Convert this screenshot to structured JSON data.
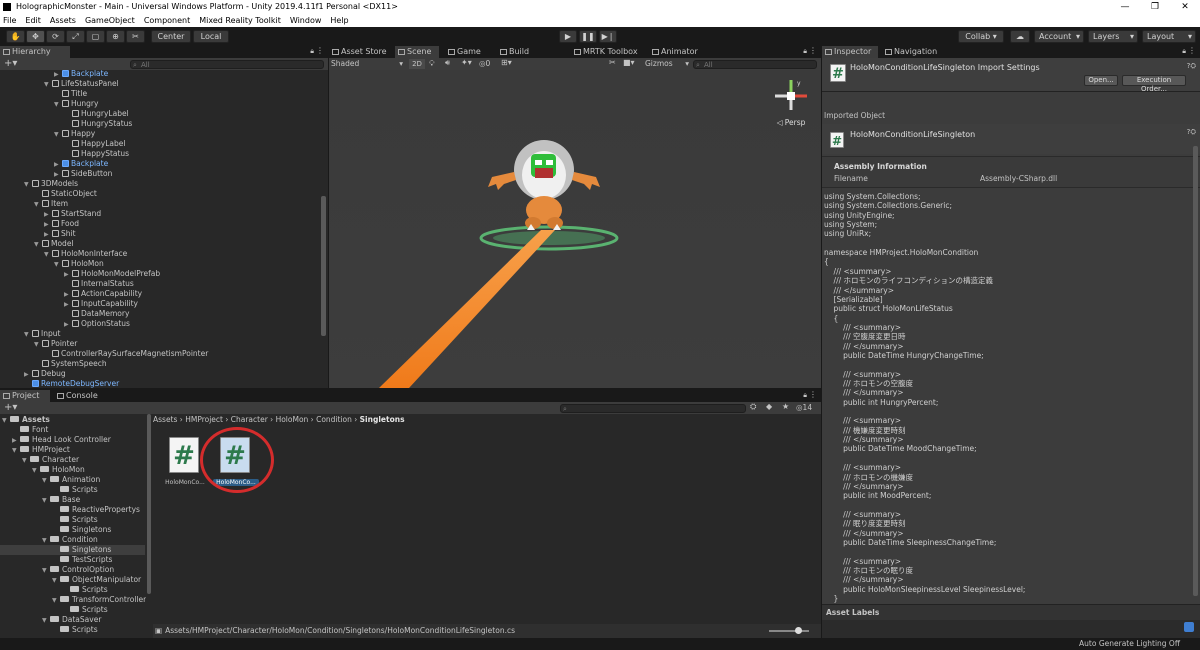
{
  "window": {
    "title": "HolographicMonster - Main - Universal Windows Platform - Unity 2019.4.11f1 Personal <DX11>",
    "controls": [
      "—",
      "❐",
      "✕"
    ]
  },
  "menu": [
    "File",
    "Edit",
    "Assets",
    "GameObject",
    "Component",
    "Mixed Reality Toolkit",
    "Window",
    "Help"
  ],
  "toolbar": {
    "center_label": "Center",
    "local_label": "Local",
    "collab_label": "Collab ▾",
    "account_label": "Account",
    "layers_label": "Layers",
    "layout_label": "Layout"
  },
  "hierarchy": {
    "tab": "Hierarchy",
    "search_placeholder": "All",
    "rows": [
      {
        "label": "Backplate",
        "indent": 5,
        "arrow": "▶",
        "blue": true
      },
      {
        "label": "LifeStatusPanel",
        "indent": 4,
        "arrow": "▼",
        "blue": false
      },
      {
        "label": "Title",
        "indent": 5,
        "arrow": "",
        "blue": false
      },
      {
        "label": "Hungry",
        "indent": 5,
        "arrow": "▼",
        "blue": false
      },
      {
        "label": "HungryLabel",
        "indent": 6,
        "arrow": "",
        "blue": false
      },
      {
        "label": "HungryStatus",
        "indent": 6,
        "arrow": "",
        "blue": false
      },
      {
        "label": "Happy",
        "indent": 5,
        "arrow": "▼",
        "blue": false
      },
      {
        "label": "HappyLabel",
        "indent": 6,
        "arrow": "",
        "blue": false
      },
      {
        "label": "HappyStatus",
        "indent": 6,
        "arrow": "",
        "blue": false
      },
      {
        "label": "Backplate",
        "indent": 5,
        "arrow": "▶",
        "blue": true
      },
      {
        "label": "SideButton",
        "indent": 5,
        "arrow": "▶",
        "blue": false
      },
      {
        "label": "3DModels",
        "indent": 2,
        "arrow": "▼",
        "blue": false
      },
      {
        "label": "StaticObject",
        "indent": 3,
        "arrow": "",
        "blue": false
      },
      {
        "label": "Item",
        "indent": 3,
        "arrow": "▼",
        "blue": false
      },
      {
        "label": "StartStand",
        "indent": 4,
        "arrow": "▶",
        "blue": false
      },
      {
        "label": "Food",
        "indent": 4,
        "arrow": "▶",
        "blue": false
      },
      {
        "label": "Shit",
        "indent": 4,
        "arrow": "▶",
        "blue": false
      },
      {
        "label": "Model",
        "indent": 3,
        "arrow": "▼",
        "blue": false
      },
      {
        "label": "HoloMonInterface",
        "indent": 4,
        "arrow": "▼",
        "blue": false
      },
      {
        "label": "HoloMon",
        "indent": 5,
        "arrow": "▼",
        "blue": false
      },
      {
        "label": "HoloMonModelPrefab",
        "indent": 6,
        "arrow": "▶",
        "blue": false
      },
      {
        "label": "InternalStatus",
        "indent": 6,
        "arrow": "",
        "blue": false
      },
      {
        "label": "ActionCapability",
        "indent": 6,
        "arrow": "▶",
        "blue": false
      },
      {
        "label": "InputCapability",
        "indent": 6,
        "arrow": "▶",
        "blue": false
      },
      {
        "label": "DataMemory",
        "indent": 6,
        "arrow": "",
        "blue": false
      },
      {
        "label": "OptionStatus",
        "indent": 6,
        "arrow": "▶",
        "blue": false
      },
      {
        "label": "Input",
        "indent": 2,
        "arrow": "▼",
        "blue": false
      },
      {
        "label": "Pointer",
        "indent": 3,
        "arrow": "▼",
        "blue": false
      },
      {
        "label": "ControllerRaySurfaceMagnetismPointer",
        "indent": 4,
        "arrow": "",
        "blue": false
      },
      {
        "label": "SystemSpeech",
        "indent": 3,
        "arrow": "",
        "blue": false
      },
      {
        "label": "Debug",
        "indent": 2,
        "arrow": "▶",
        "blue": false
      },
      {
        "label": "RemoteDebugServer",
        "indent": 2,
        "arrow": "",
        "blue": true
      }
    ]
  },
  "scene": {
    "tabs": [
      "Asset Store",
      "Scene",
      "Game",
      "Build Window",
      "MRTK Toolbox",
      "Animator"
    ],
    "shading": "Shaded",
    "mode_2d": "2D",
    "hidden_count": "0",
    "gizmos": "Gizmos",
    "search_placeholder": "All",
    "persp_label": "◁ Persp"
  },
  "project": {
    "tabs": [
      "Project",
      "Console"
    ],
    "breadcrumb": [
      "Assets",
      "HMProject",
      "Character",
      "HoloMon",
      "Condition",
      "Singletons"
    ],
    "favorites_count": "14",
    "tree": [
      {
        "label": "Assets",
        "indent": 0,
        "arrow": "▼",
        "bold": true
      },
      {
        "label": "Font",
        "indent": 1,
        "arrow": ""
      },
      {
        "label": "Head Look Controller",
        "indent": 1,
        "arrow": "▶"
      },
      {
        "label": "HMProject",
        "indent": 1,
        "arrow": "▼"
      },
      {
        "label": "Character",
        "indent": 2,
        "arrow": "▼"
      },
      {
        "label": "HoloMon",
        "indent": 3,
        "arrow": "▼"
      },
      {
        "label": "Animation",
        "indent": 4,
        "arrow": "▼"
      },
      {
        "label": "Scripts",
        "indent": 5,
        "arrow": ""
      },
      {
        "label": "Base",
        "indent": 4,
        "arrow": "▼"
      },
      {
        "label": "ReactivePropertys",
        "indent": 5,
        "arrow": ""
      },
      {
        "label": "Scripts",
        "indent": 5,
        "arrow": ""
      },
      {
        "label": "Singletons",
        "indent": 5,
        "arrow": ""
      },
      {
        "label": "Condition",
        "indent": 4,
        "arrow": "▼"
      },
      {
        "label": "Singletons",
        "indent": 5,
        "arrow": "",
        "selected": true
      },
      {
        "label": "TestScripts",
        "indent": 5,
        "arrow": ""
      },
      {
        "label": "ControlOption",
        "indent": 4,
        "arrow": "▼"
      },
      {
        "label": "ObjectManipulator",
        "indent": 5,
        "arrow": "▼"
      },
      {
        "label": "Scripts",
        "indent": 6,
        "arrow": ""
      },
      {
        "label": "TransformController",
        "indent": 5,
        "arrow": "▼"
      },
      {
        "label": "Scripts",
        "indent": 6,
        "arrow": ""
      },
      {
        "label": "DataSaver",
        "indent": 4,
        "arrow": "▼"
      },
      {
        "label": "Scripts",
        "indent": 5,
        "arrow": ""
      }
    ],
    "assets": [
      {
        "label": "HoloMonCo...",
        "selected": false
      },
      {
        "label": "HoloMonCo...",
        "selected": true
      }
    ],
    "path": "Assets/HMProject/Character/HoloMon/Condition/Singletons/HoloMonConditionLifeSingleton.cs"
  },
  "inspector": {
    "tabs": [
      "Inspector",
      "Navigation"
    ],
    "header_title": "HoloMonConditionLifeSingleton Import Settings",
    "open_button": "Open...",
    "exec_order_button": "Execution Order...",
    "imported_object_label": "Imported Object",
    "object_name": "HoloMonConditionLifeSingleton",
    "assembly_info_label": "Assembly Information",
    "filename_label": "Filename",
    "filename_value": "Assembly-CSharp.dll",
    "code_lines": [
      "using System.Collections;",
      "using System.Collections.Generic;",
      "using UnityEngine;",
      "using System;",
      "using UniRx;",
      "",
      "namespace HMProject.HoloMonCondition",
      "{",
      "    /// <summary>",
      "    /// ホロモンのライフコンディションの構造定義",
      "    /// </summary>",
      "    [Serializable]",
      "    public struct HoloMonLifeStatus",
      "    {",
      "        /// <summary>",
      "        /// 空腹度変更日時",
      "        /// </summary>",
      "        public DateTime HungryChangeTime;",
      "",
      "        /// <summary>",
      "        /// ホロモンの空腹度",
      "        /// </summary>",
      "        public int HungryPercent;",
      "",
      "        /// <summary>",
      "        /// 機嫌度変更時刻",
      "        /// </summary>",
      "        public DateTime MoodChangeTime;",
      "",
      "        /// <summary>",
      "        /// ホロモンの機嫌度",
      "        /// </summary>",
      "        public int MoodPercent;",
      "",
      "        /// <summary>",
      "        /// 眠り度変更時刻",
      "        /// </summary>",
      "        public DateTime SleepinessChangeTime;",
      "",
      "        /// <summary>",
      "        /// ホロモンの眠り度",
      "        /// </summary>",
      "        public HoloMonSleepinessLevel SleepinessLevel;",
      "    }"
    ],
    "asset_labels": "Asset Labels"
  },
  "status": {
    "right_text": "Auto Generate Lighting Off"
  },
  "colors": {
    "selection_circle": "#d42c2c",
    "laser": "#f07a1a",
    "ring": "#5fc87a",
    "blue_prefab": "#7db7ff"
  }
}
